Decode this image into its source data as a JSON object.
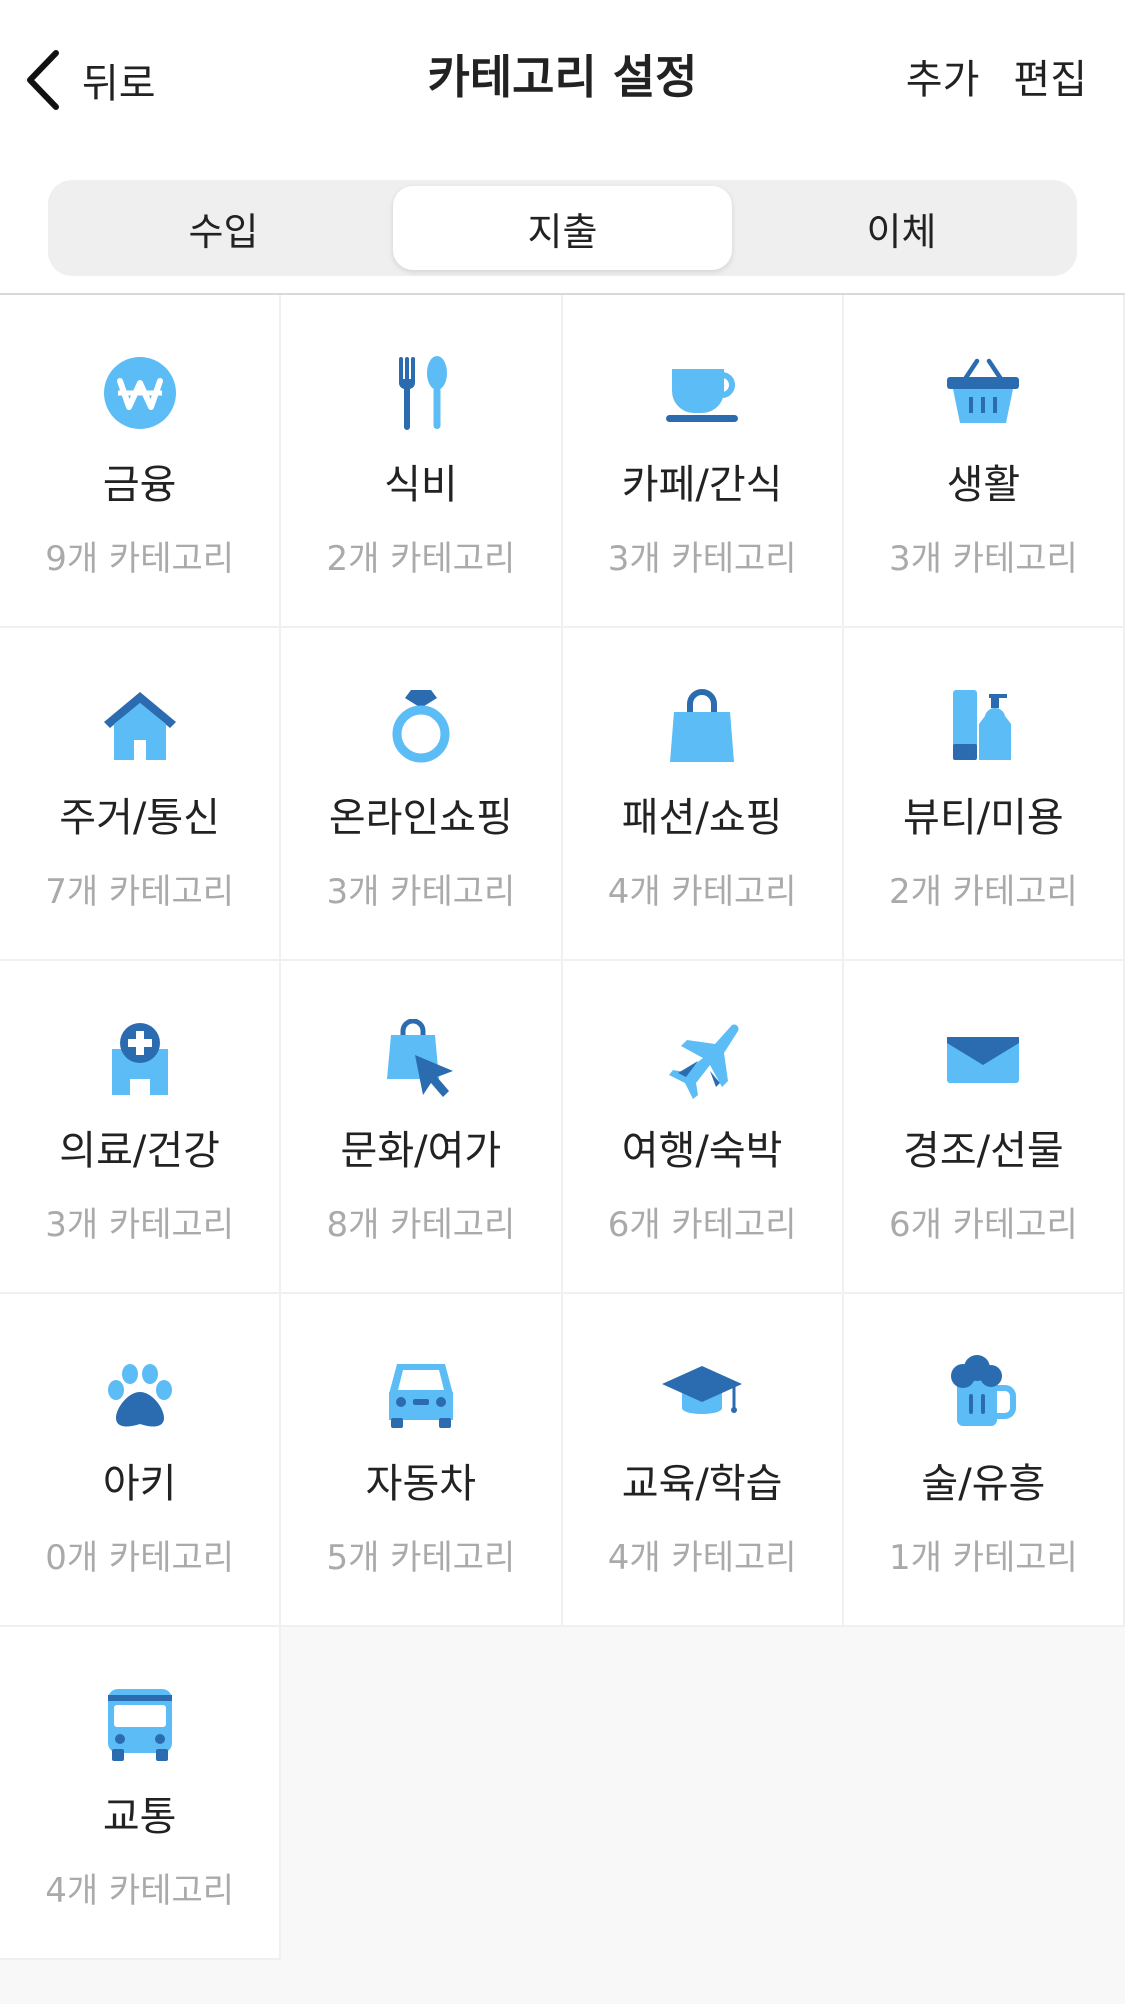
{
  "header": {
    "back_label": "뒤로",
    "title": "카테고리 설정",
    "add_label": "추가",
    "edit_label": "편집"
  },
  "tabs": [
    {
      "label": "수입",
      "active": false
    },
    {
      "label": "지출",
      "active": true
    },
    {
      "label": "이체",
      "active": false
    }
  ],
  "colors": {
    "light": "#5cbcf5",
    "dark": "#2b6cb0"
  },
  "categories": [
    {
      "name": "금융",
      "count": "9개 카테고리",
      "icon": "won-coin-icon"
    },
    {
      "name": "식비",
      "count": "2개 카테고리",
      "icon": "fork-spoon-icon"
    },
    {
      "name": "카페/간식",
      "count": "3개 카테고리",
      "icon": "coffee-cup-icon"
    },
    {
      "name": "생활",
      "count": "3개 카테고리",
      "icon": "basket-icon"
    },
    {
      "name": "주거/통신",
      "count": "7개 카테고리",
      "icon": "house-icon"
    },
    {
      "name": "온라인쇼핑",
      "count": "3개 카테고리",
      "icon": "ring-icon"
    },
    {
      "name": "패션/쇼핑",
      "count": "4개 카테고리",
      "icon": "shopping-bag-icon"
    },
    {
      "name": "뷰티/미용",
      "count": "2개 카테고리",
      "icon": "cosmetics-icon"
    },
    {
      "name": "의료/건강",
      "count": "3개 카테고리",
      "icon": "hospital-icon"
    },
    {
      "name": "문화/여가",
      "count": "8개 카테고리",
      "icon": "bag-cursor-icon"
    },
    {
      "name": "여행/숙박",
      "count": "6개 카테고리",
      "icon": "airplane-icon"
    },
    {
      "name": "경조/선물",
      "count": "6개 카테고리",
      "icon": "envelope-icon"
    },
    {
      "name": "아키",
      "count": "0개 카테고리",
      "icon": "paw-icon"
    },
    {
      "name": "자동차",
      "count": "5개 카테고리",
      "icon": "car-icon"
    },
    {
      "name": "교육/학습",
      "count": "4개 카테고리",
      "icon": "graduation-cap-icon"
    },
    {
      "name": "술/유흥",
      "count": "1개 카테고리",
      "icon": "beer-mug-icon"
    },
    {
      "name": "교통",
      "count": "4개 카테고리",
      "icon": "bus-icon"
    }
  ]
}
